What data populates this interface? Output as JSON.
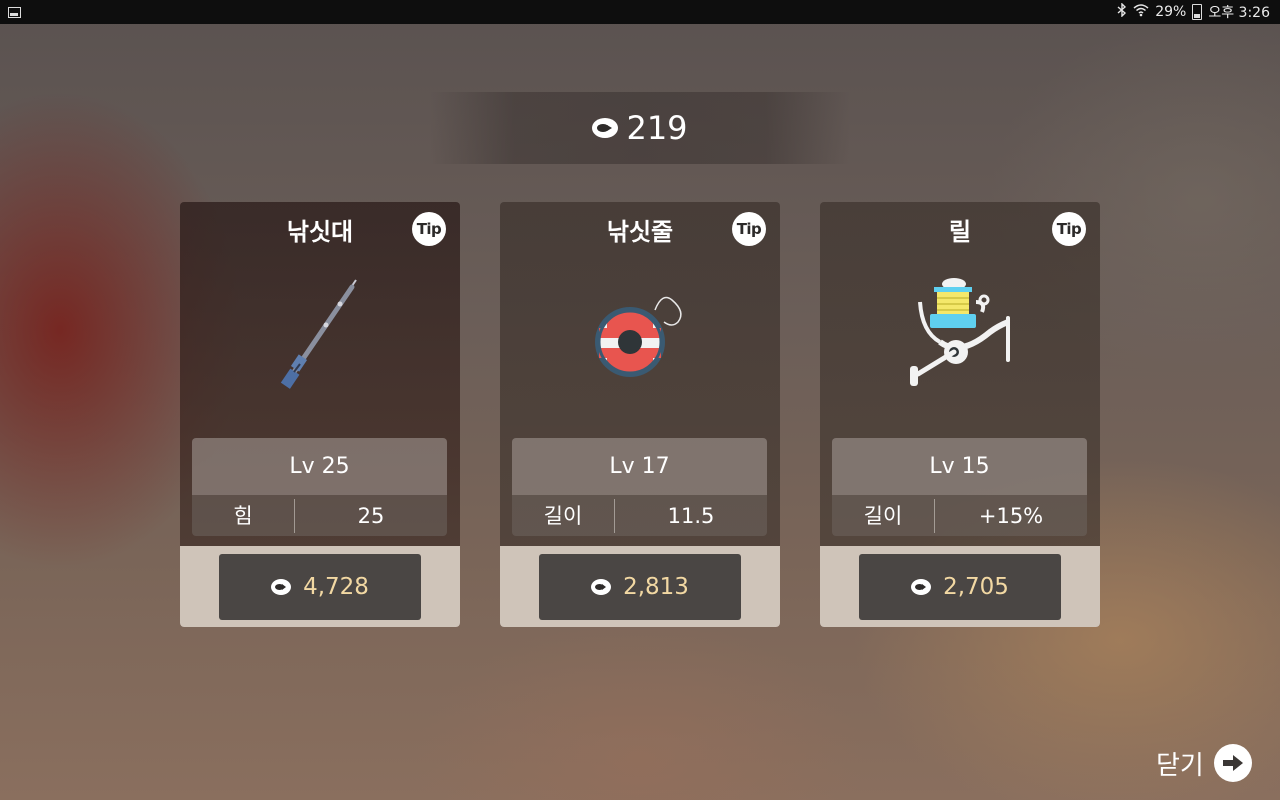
{
  "status_bar": {
    "battery": "29%",
    "time": "오후 3:26",
    "icons": [
      "image-notification-icon",
      "bluetooth-icon",
      "wifi-icon",
      "battery-icon"
    ]
  },
  "currency": {
    "amount": "219",
    "icon": "fish-coin-icon"
  },
  "cards": [
    {
      "title": "낚싯대",
      "tip_label": "Tip",
      "level": "Lv 25",
      "stat_label": "힘",
      "stat_value": "25",
      "price": "4,728",
      "icon": "fishing-rod-icon"
    },
    {
      "title": "낚싯줄",
      "tip_label": "Tip",
      "level": "Lv 17",
      "stat_label": "길이",
      "stat_value": "11.5",
      "price": "2,813",
      "icon": "fishing-line-spool-icon"
    },
    {
      "title": "릴",
      "tip_label": "Tip",
      "level": "Lv 15",
      "stat_label": "길이",
      "stat_value": "+15%",
      "price": "2,705",
      "icon": "fishing-reel-icon"
    }
  ],
  "close_label": "닫기",
  "colors": {
    "price_text": "#f2d8a3",
    "buy_button": "#4a4644",
    "card_footer": "#cfc4b9"
  }
}
